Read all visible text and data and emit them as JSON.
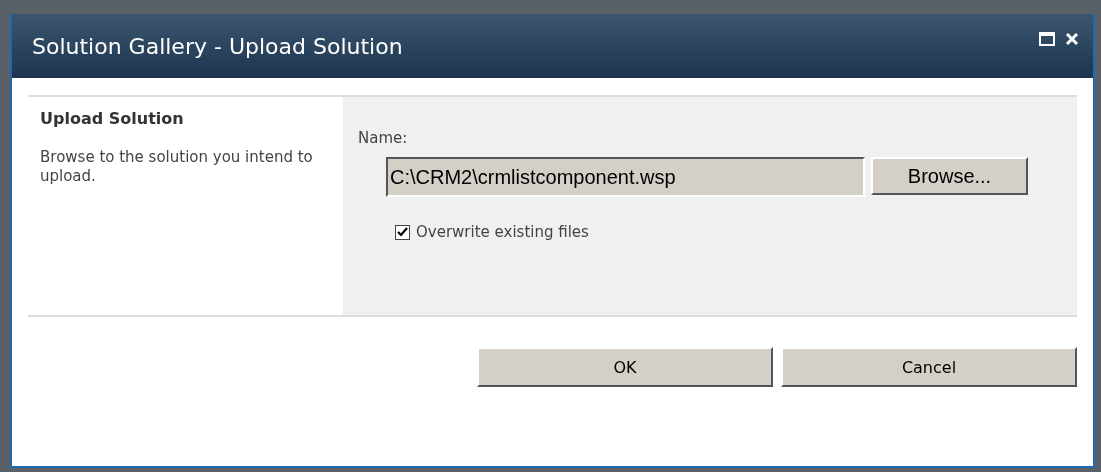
{
  "window": {
    "title": "Solution Gallery - Upload Solution"
  },
  "section": {
    "heading": "Upload Solution",
    "description": "Browse to the solution you intend to upload."
  },
  "name_field": {
    "label": "Name:",
    "value": "C:\\CRM2\\crmlistcomponent.wsp",
    "browse_button": "Browse..."
  },
  "overwrite": {
    "label": "Overwrite existing files",
    "checked": true
  },
  "buttons": [
    "OK",
    "Cancel"
  ]
}
